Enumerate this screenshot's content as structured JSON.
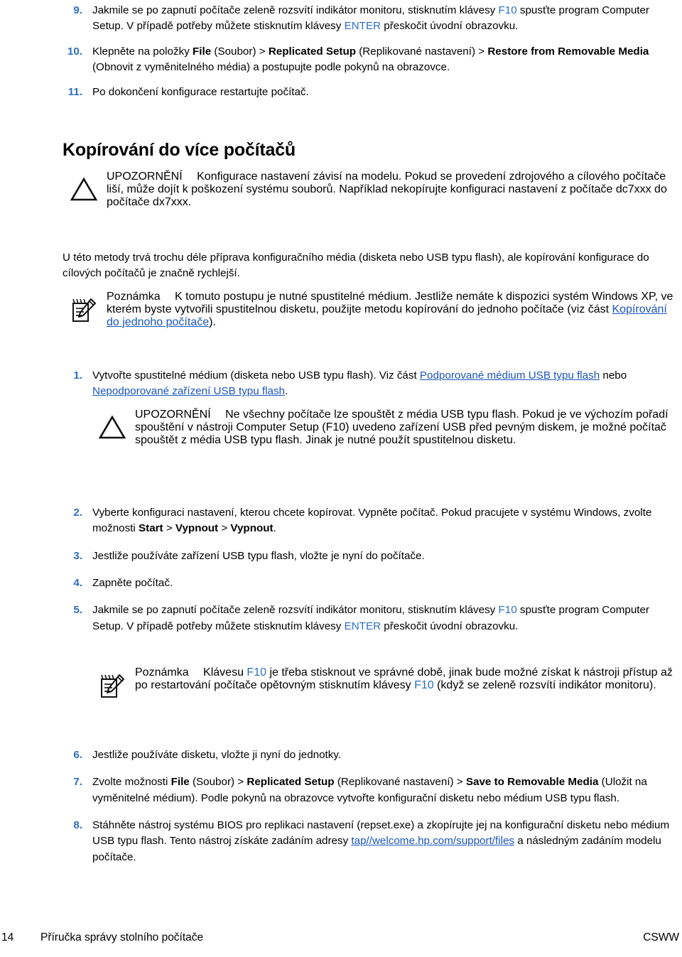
{
  "document": {
    "language": "cs",
    "colors": {
      "accent_blue": "#2c6fc4",
      "rule_blue": "#4a86c8",
      "link_blue": "#1b55bd",
      "text_black": "#000000",
      "background": "#ffffff"
    }
  },
  "top_list": {
    "items": [
      {
        "number": "9.",
        "parts": [
          {
            "t": "Jakmile se po zapnutí počítače zeleně rozsvítí indikátor monitoru, stisknutím klávesy ",
            "s": "plain"
          },
          {
            "t": "F10",
            "s": "key"
          },
          {
            "t": " spusťte program Computer Setup. V případě potřeby můžete stisknutím klávesy ",
            "s": "plain"
          },
          {
            "t": "ENTER",
            "s": "key"
          },
          {
            "t": " přeskočit úvodní obrazovku.",
            "s": "plain"
          }
        ]
      },
      {
        "number": "10.",
        "parts": [
          {
            "t": "Klepněte na položky ",
            "s": "plain"
          },
          {
            "t": "File",
            "s": "bold"
          },
          {
            "t": " (Soubor) > ",
            "s": "plain"
          },
          {
            "t": "Replicated Setup",
            "s": "bold"
          },
          {
            "t": " (Replikované nastavení) > ",
            "s": "plain"
          },
          {
            "t": "Restore from Removable Media",
            "s": "bold"
          },
          {
            "t": " (Obnovit z vyměnitelného média) a postupujte podle pokynů na obrazovce.",
            "s": "plain"
          }
        ]
      },
      {
        "number": "11.",
        "parts": [
          {
            "t": "Po dokončení konfigurace restartujte počítač.",
            "s": "plain"
          }
        ]
      }
    ]
  },
  "section": {
    "title": "Kopírování do více počítačů"
  },
  "caution_1": {
    "icon": "caution-triangle-icon",
    "label": "UPOZORNĚNÍ",
    "parts": [
      {
        "t": "Konfigurace nastavení závisí na modelu. Pokud se provedení zdrojového a cílového počítače liší, může dojít k poškození systému souborů. Například nekopírujte konfiguraci nastavení z počítače dc7xxx do počítače dx7xxx.",
        "s": "plain"
      }
    ]
  },
  "paragraph_1": {
    "text": "U této metody trvá trochu déle příprava konfiguračního média (disketa nebo USB typu flash), ale kopírování konfigurace do cílových počítačů je značně rychlejší."
  },
  "note_1": {
    "icon": "note-pencil-icon",
    "label": "Poznámka",
    "parts": [
      {
        "t": "K tomuto postupu je nutné spustitelné médium. Jestliže nemáte k dispozici systém Windows XP, ve kterém byste vytvořili spustitelnou disketu, použijte metodu kopírování do jednoho počítače (viz část ",
        "s": "plain"
      },
      {
        "t": "Kopírování do jednoho počítače",
        "s": "link"
      },
      {
        "t": ").",
        "s": "plain"
      }
    ]
  },
  "main_list": {
    "items": [
      {
        "number": "1.",
        "parts": [
          {
            "t": "Vytvořte spustitelné médium (disketa nebo USB typu flash). Viz část ",
            "s": "plain"
          },
          {
            "t": "Podporované médium USB typu flash",
            "s": "link"
          },
          {
            "t": " nebo ",
            "s": "plain"
          },
          {
            "t": "Nepodporované zařízení USB typu flash",
            "s": "link"
          },
          {
            "t": ".",
            "s": "plain"
          }
        ]
      },
      {
        "number": "2.",
        "parts": [
          {
            "t": "Vyberte konfiguraci nastavení, kterou chcete kopírovat. Vypněte počítač. Pokud pracujete v systému Windows, zvolte možnosti ",
            "s": "plain"
          },
          {
            "t": "Start",
            "s": "bold"
          },
          {
            "t": " > ",
            "s": "plain"
          },
          {
            "t": "Vypnout",
            "s": "bold"
          },
          {
            "t": " > ",
            "s": "plain"
          },
          {
            "t": "Vypnout",
            "s": "bold"
          },
          {
            "t": ".",
            "s": "plain"
          }
        ]
      },
      {
        "number": "3.",
        "parts": [
          {
            "t": "Jestliže používáte zařízení USB typu flash, vložte je nyní do počítače.",
            "s": "plain"
          }
        ]
      },
      {
        "number": "4.",
        "parts": [
          {
            "t": "Zapněte počítač.",
            "s": "plain"
          }
        ]
      },
      {
        "number": "5.",
        "parts": [
          {
            "t": "Jakmile se po zapnutí počítače zeleně rozsvítí indikátor monitoru, stisknutím klávesy ",
            "s": "plain"
          },
          {
            "t": "F10",
            "s": "key"
          },
          {
            "t": " spusťte program Computer Setup. V případě potřeby můžete stisknutím klávesy ",
            "s": "plain"
          },
          {
            "t": "ENTER",
            "s": "key"
          },
          {
            "t": " přeskočit úvodní obrazovku.",
            "s": "plain"
          }
        ]
      },
      {
        "number": "6.",
        "parts": [
          {
            "t": "Jestliže používáte disketu, vložte ji nyní do jednotky.",
            "s": "plain"
          }
        ]
      },
      {
        "number": "7.",
        "parts": [
          {
            "t": "Zvolte možnosti ",
            "s": "plain"
          },
          {
            "t": "File",
            "s": "bold"
          },
          {
            "t": " (Soubor) > ",
            "s": "plain"
          },
          {
            "t": "Replicated Setup",
            "s": "bold"
          },
          {
            "t": " (Replikované nastavení) > ",
            "s": "plain"
          },
          {
            "t": "Save to Removable Media",
            "s": "bold"
          },
          {
            "t": " (Uložit na vyměnitelné médium). Podle pokynů na obrazovce vytvořte konfigurační disketu nebo médium USB typu flash.",
            "s": "plain"
          }
        ]
      },
      {
        "number": "8.",
        "parts": [
          {
            "t": "Stáhněte nástroj systému BIOS pro replikaci nastavení (repset.exe) a zkopírujte jej na konfigurační disketu nebo médium USB typu flash. Tento nástroj získáte zadáním adresy ",
            "s": "plain"
          },
          {
            "t": "tap//welcome.hp.com/support/files",
            "s": "link"
          },
          {
            "t": " a následným zadáním modelu počítače.",
            "s": "plain"
          }
        ]
      }
    ]
  },
  "caution_2": {
    "icon": "caution-triangle-icon",
    "label": "UPOZORNĚNÍ",
    "parts": [
      {
        "t": "Ne všechny počítače lze spouštět z média USB typu flash. Pokud je ve výchozím pořadí spouštění v nástroji Computer Setup (F10) uvedeno zařízení USB před pevným diskem, je možné počítač spouštět z média USB typu flash. Jinak je nutné použít spustitelnou disketu.",
        "s": "plain"
      }
    ]
  },
  "note_2": {
    "icon": "note-pencil-icon",
    "label": "Poznámka",
    "parts": [
      {
        "t": "Klávesu ",
        "s": "plain"
      },
      {
        "t": "F10",
        "s": "key"
      },
      {
        "t": " je třeba stisknout ve správné době, jinak bude možné získat k nástroji přístup až po restartování počítače opětovným stisknutím klávesy ",
        "s": "plain"
      },
      {
        "t": "F10",
        "s": "key"
      },
      {
        "t": " (když se zeleně rozsvítí indikátor monitoru).",
        "s": "plain"
      }
    ]
  },
  "footer": {
    "page_number": "14",
    "doc_title": "Příručka správy stolního počítače",
    "language_code": "CSWW"
  }
}
